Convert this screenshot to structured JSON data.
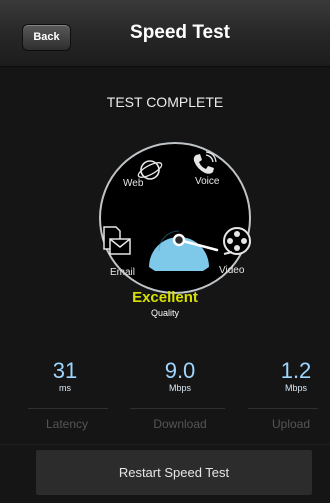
{
  "navbar": {
    "back_label": "Back",
    "title": "Speed Test"
  },
  "status": "TEST COMPLETE",
  "gauge": {
    "labels": {
      "web": "Web",
      "voice": "Voice",
      "email": "Email",
      "video": "Video"
    },
    "icons": [
      "globe-icon",
      "phone-icon",
      "document-envelope-icon",
      "film-reel-icon",
      "speedometer-icon"
    ],
    "rating": "Excellent",
    "rating_sub": "Quality",
    "colors": {
      "rating": "#d7e000",
      "dial": "#7ec8ea"
    }
  },
  "metrics": [
    {
      "value": "31",
      "unit": "ms",
      "label": "Latency"
    },
    {
      "value": "9.0",
      "unit": "Mbps",
      "label": "Download"
    },
    {
      "value": "1.2",
      "unit": "Mbps",
      "label": "Upload"
    }
  ],
  "restart_label": "Restart Speed Test"
}
